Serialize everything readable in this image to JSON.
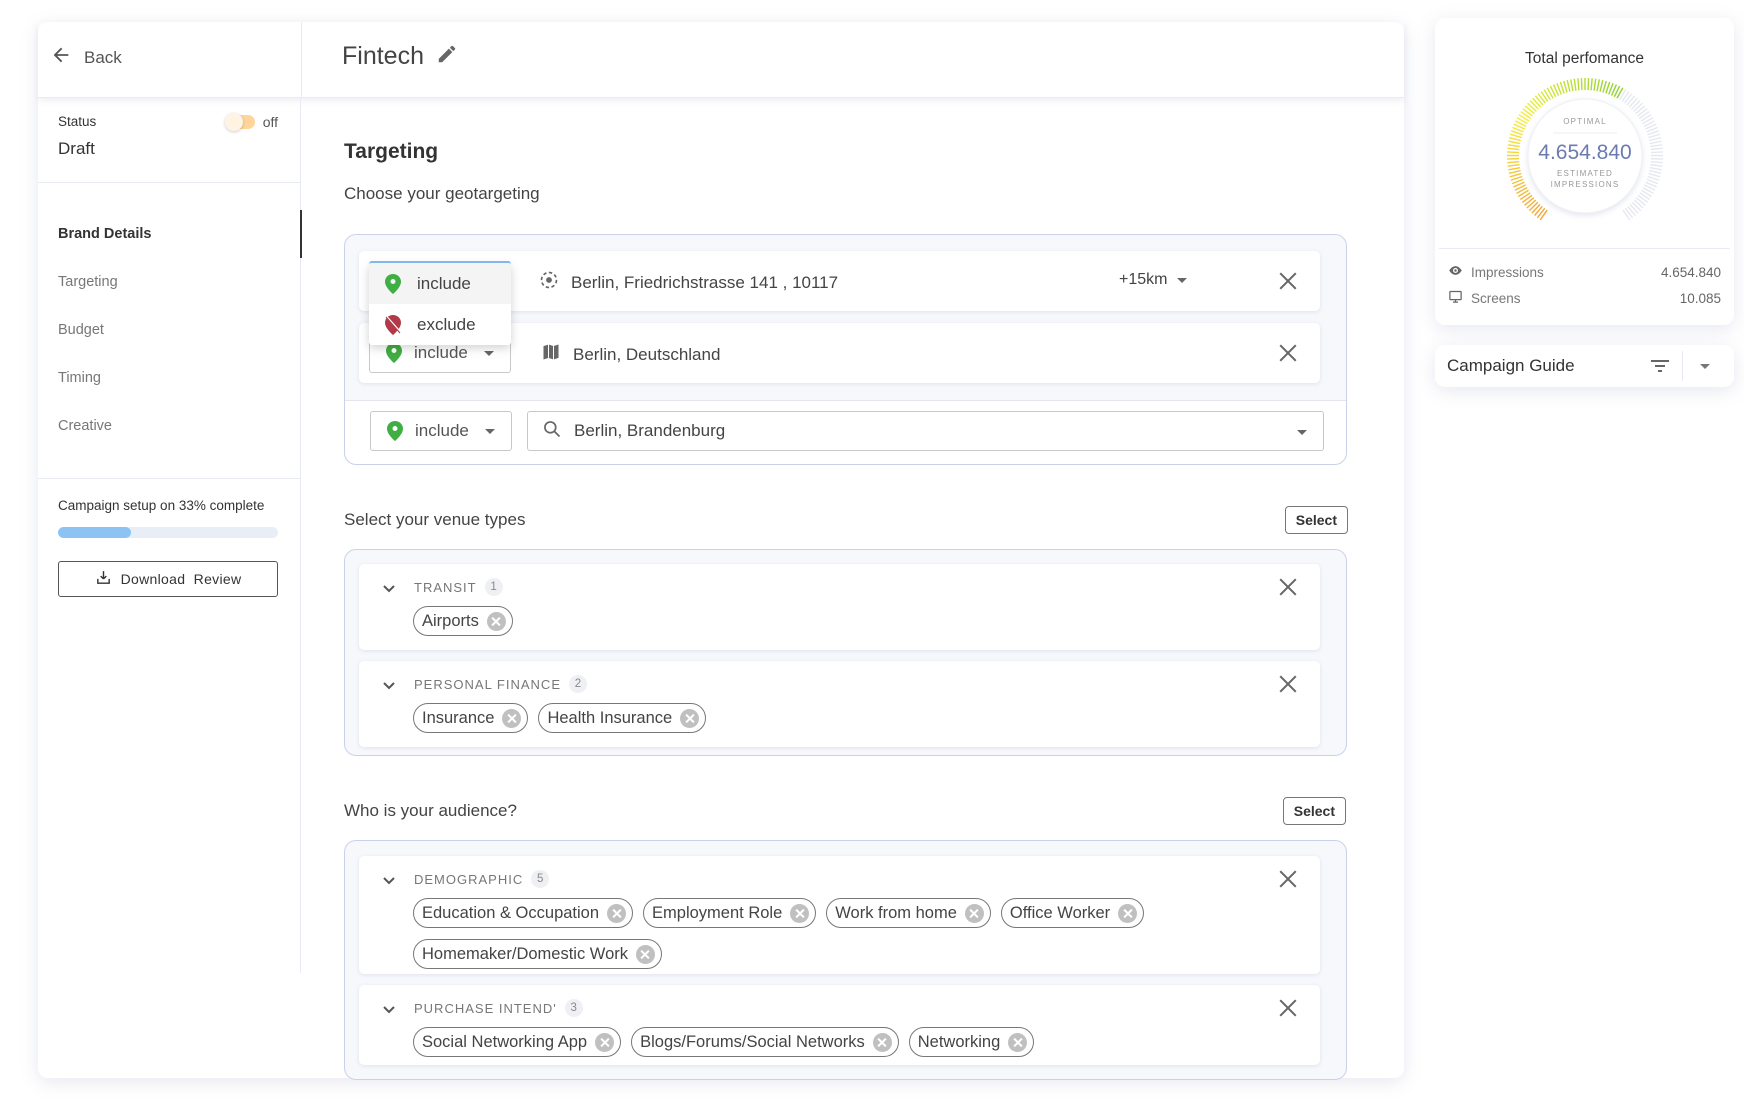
{
  "header": {
    "back_label": "Back",
    "title": "Fintech"
  },
  "sidebar": {
    "status_label": "Status",
    "status_value": "Draft",
    "toggle_label": "off",
    "toggle_on": false,
    "nav": [
      {
        "label": "Brand Details",
        "active": true
      },
      {
        "label": "Targeting",
        "active": false
      },
      {
        "label": "Budget",
        "active": false
      },
      {
        "label": "Timing",
        "active": false
      },
      {
        "label": "Creative",
        "active": false
      }
    ],
    "progress_label": "Campaign setup on 33% complete",
    "progress_percent": 33,
    "download_label": "Download  Review"
  },
  "targeting": {
    "title": "Targeting",
    "geo_subtitle": "Choose your geotargeting",
    "dropdown_options": [
      {
        "label": "include",
        "icon": "pin-icon"
      },
      {
        "label": "exclude",
        "icon": "pin-off-icon"
      }
    ],
    "geo_rows": [
      {
        "mode": "include",
        "icon": "gps-target-icon",
        "location": "Berlin, Friedrichstrasse 141 , 10117",
        "radius": "+15km"
      },
      {
        "mode": "include",
        "icon": "map-icon",
        "location": "Berlin, Deutschland"
      }
    ],
    "new_row": {
      "mode": "include",
      "search_value": "Berlin, Brandenburg"
    }
  },
  "venues": {
    "title": "Select your venue types",
    "select_label": "Select",
    "groups": [
      {
        "name": "TRANSIT",
        "count": "1",
        "items": [
          "Airports"
        ]
      },
      {
        "name": "PERSONAL FINANCE",
        "count": "2",
        "items": [
          "Insurance",
          "Health Insurance"
        ]
      }
    ]
  },
  "audience": {
    "title": "Who is your audience?",
    "select_label": "Select",
    "groups": [
      {
        "name": "DEMOGRAPHIC",
        "count": "5",
        "items": [
          "Education & Occupation",
          "Employment Role",
          "Work from home",
          "Office Worker",
          "Homemaker/Domestic Work"
        ]
      },
      {
        "name": "PURCHASE INTEND'",
        "count": "3",
        "items": [
          "Social Networking App",
          "Blogs/Forums/Social Networks",
          "Networking"
        ]
      }
    ]
  },
  "performance": {
    "title": "Total perfomance",
    "gauge_label": "OPTIMAL",
    "gauge_value": "4.654.840",
    "gauge_caption_1": "ESTIMATED",
    "gauge_caption_2": "IMPRESSIONS",
    "gauge_fill_fraction": 0.6,
    "colors": {
      "low": "#f2a53a",
      "mid": "#f5ee3c",
      "high": "#8fd230",
      "empty": "#e6e8ef",
      "value": "#6b7bb0"
    },
    "stats": [
      {
        "icon": "eye-icon",
        "label": "Impressions",
        "value": "4.654.840"
      },
      {
        "icon": "monitor-icon",
        "label": "Screens",
        "value": "10.085"
      }
    ]
  },
  "guide": {
    "title": "Campaign Guide"
  }
}
